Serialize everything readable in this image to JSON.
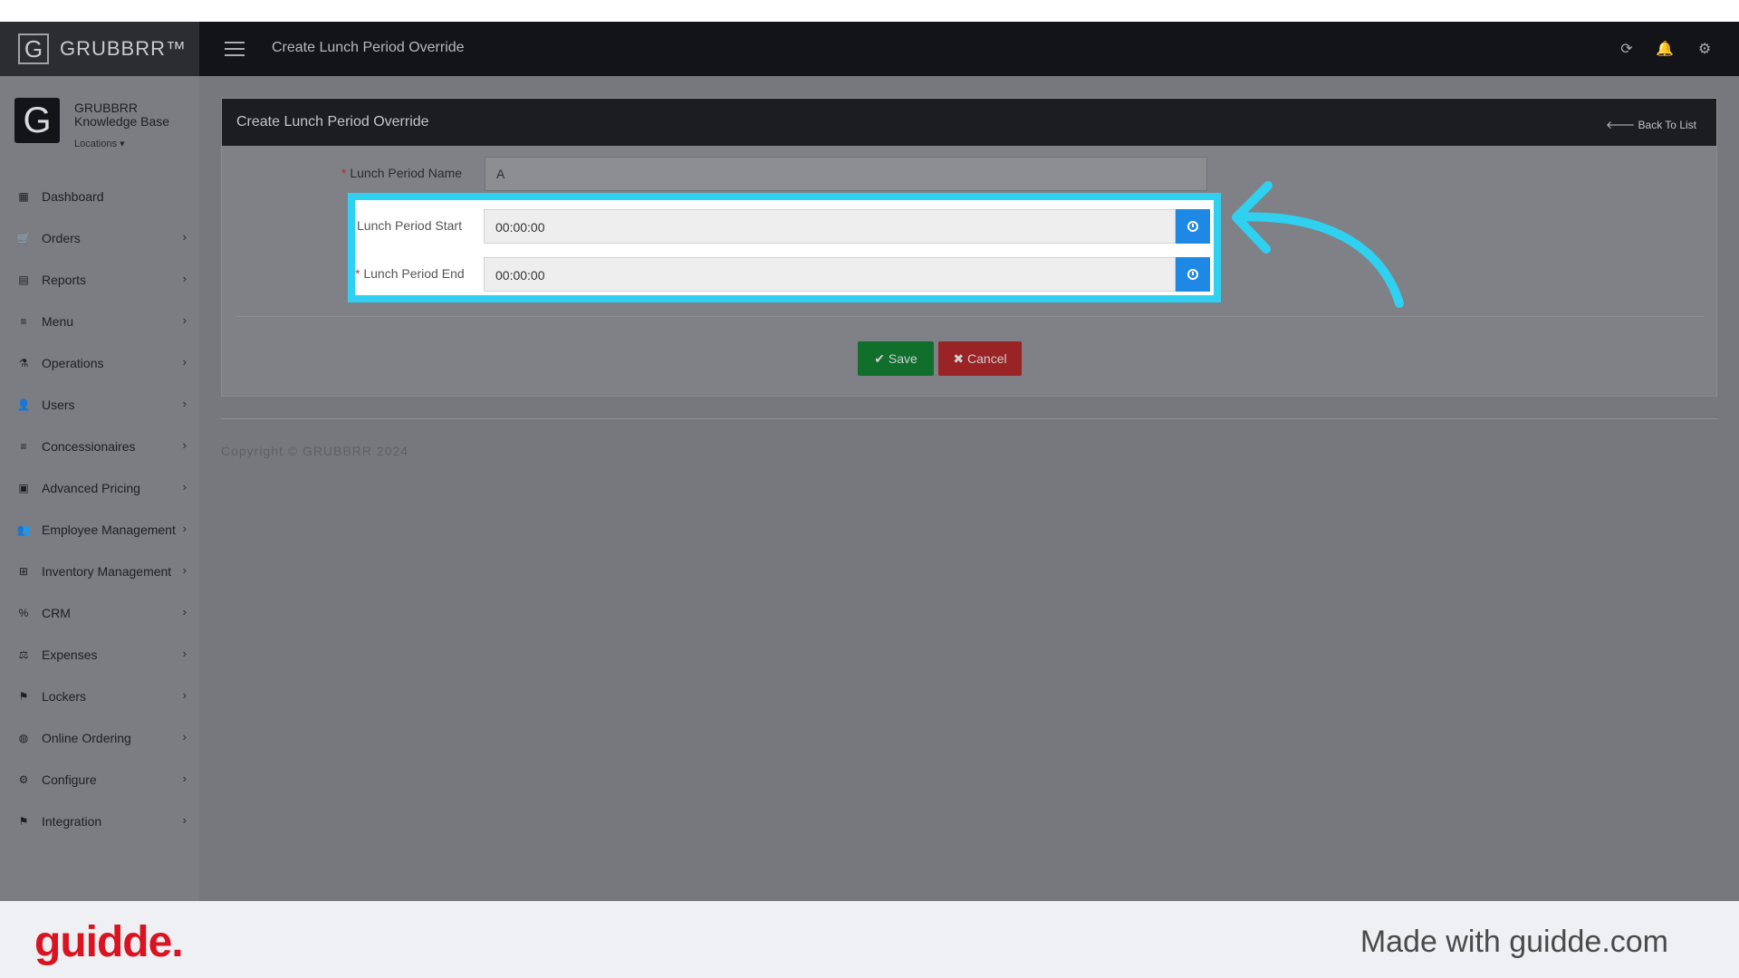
{
  "app": {
    "brand": "GRUBBRR™",
    "brand_letter": "G",
    "header_title": "Create Lunch Period Override"
  },
  "profile": {
    "avatar_letter": "G",
    "name_line1": "GRUBBRR",
    "name_line2": "Knowledge Base",
    "locations_label": "Locations ▾"
  },
  "sidebar": {
    "items": [
      {
        "label": "Dashboard",
        "icon": "▦",
        "chevron": ""
      },
      {
        "label": "Orders",
        "icon": "🛒",
        "chevron": "›"
      },
      {
        "label": "Reports",
        "icon": "▤",
        "chevron": "›"
      },
      {
        "label": "Menu",
        "icon": "≡",
        "chevron": "›"
      },
      {
        "label": "Operations",
        "icon": "⚗",
        "chevron": "›"
      },
      {
        "label": "Users",
        "icon": "👤",
        "chevron": "›"
      },
      {
        "label": "Concessionaires",
        "icon": "≡",
        "chevron": "›"
      },
      {
        "label": "Advanced Pricing",
        "icon": "▣",
        "chevron": "›"
      },
      {
        "label": "Employee Management",
        "icon": "👥",
        "chevron": "›"
      },
      {
        "label": "Inventory Management",
        "icon": "⊞",
        "chevron": "›"
      },
      {
        "label": "CRM",
        "icon": "%",
        "chevron": "›"
      },
      {
        "label": "Expenses",
        "icon": "⚖",
        "chevron": "›"
      },
      {
        "label": "Lockers",
        "icon": "⚑",
        "chevron": "›"
      },
      {
        "label": "Online Ordering",
        "icon": "◍",
        "chevron": "›"
      },
      {
        "label": "Configure",
        "icon": "⚙",
        "chevron": "›"
      },
      {
        "label": "Integration",
        "icon": "⚑",
        "chevron": "›"
      }
    ]
  },
  "panel": {
    "title": "Create Lunch Period Override",
    "back_label": "🡐 Back To List",
    "name_label": "Lunch Period Name",
    "name_value": "A",
    "start_label": "Lunch Period Start",
    "start_value": "00:00:00",
    "end_label": "Lunch Period End",
    "end_value": "00:00:00",
    "required_mark": "*",
    "save_label": "✔ Save",
    "cancel_label": "✖ Cancel"
  },
  "footer": {
    "copyright": "Copyright © GRUBBRR 2024"
  },
  "branding": {
    "logo": "guidde.",
    "made_with": "Made with guidde.com"
  },
  "colors": {
    "highlight": "#2fd0f0",
    "time_button": "#1e88e5",
    "save": "#0f6f2b",
    "cancel": "#9a2325",
    "guidde_red": "#d9131f"
  }
}
